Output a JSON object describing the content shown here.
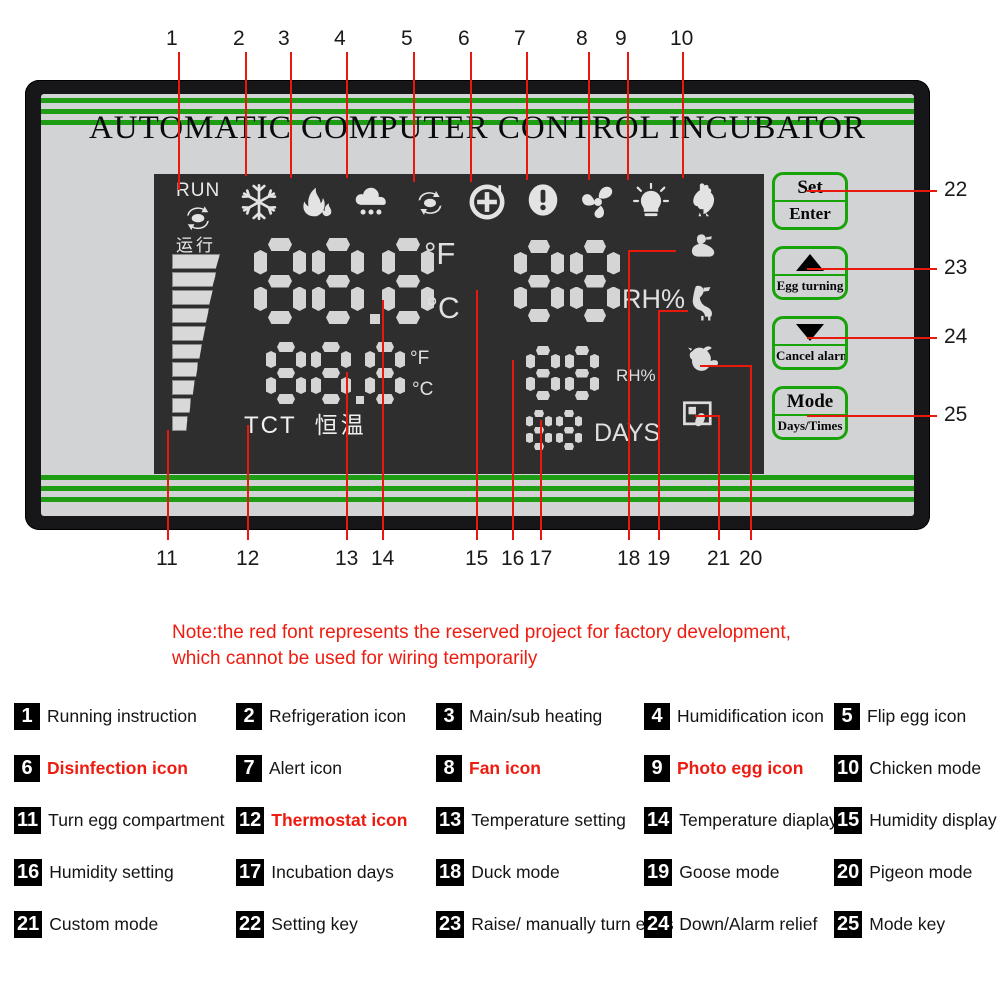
{
  "device": {
    "title": "AUTOMATIC  COMPUTER  CONTROL  INCUBATOR",
    "lcd": {
      "run_label": "RUN",
      "run_label_cn": "运行",
      "temperature_display": "88.8",
      "temperature_setting": "88.8",
      "unit_f": "°F",
      "unit_c": "°C",
      "humidity_display": "88",
      "humidity_setting": "88",
      "humidity_unit": "RH%",
      "days_value": "88",
      "days_unit": "DAYS",
      "thermostat_label": "TCT",
      "thermostat_label_cn": "恒温",
      "status_icons": [
        "running-egg-turn-icon",
        "snowflake-refrigeration-icon",
        "flame-heating-icon",
        "rain-cloud-humidification-icon",
        "flip-egg-icon",
        "plus-circle-disinfection-icon",
        "alert-exclamation-icon",
        "fan-icon",
        "lamp-photo-egg-icon",
        "rooster-chicken-mode-icon"
      ],
      "mode_icons": [
        "duck-mode-icon",
        "goose-mode-icon",
        "pigeon-mode-icon",
        "custom-mode-icon"
      ]
    },
    "buttons": [
      {
        "top": "Set",
        "bottom": "Enter",
        "icon": "none"
      },
      {
        "top": "",
        "bottom": "Egg turning",
        "icon": "up-arrow-icon"
      },
      {
        "top": "",
        "bottom": "Cancel alarm",
        "icon": "down-arrow-icon"
      },
      {
        "top": "Mode",
        "bottom": "Days/Times",
        "icon": "none"
      }
    ],
    "accent_green": "#18a409",
    "callout_red": "#e8180c"
  },
  "callouts": {
    "top": [
      "1",
      "2",
      "3",
      "4",
      "5",
      "6",
      "7",
      "8",
      "9",
      "10"
    ],
    "bottom": [
      "11",
      "12",
      "13",
      "14",
      "15",
      "16",
      "17",
      "18",
      "19",
      "21",
      "20"
    ],
    "right": [
      "22",
      "23",
      "24",
      "25"
    ]
  },
  "note": {
    "line1": "Note:the red font represents the reserved project for factory development,",
    "line2": "which cannot be used for wiring temporarily"
  },
  "legend": [
    {
      "num": "1",
      "label": "Running instruction",
      "red": false
    },
    {
      "num": "2",
      "label": "Refrigeration icon",
      "red": false
    },
    {
      "num": "3",
      "label": "Main/sub heating",
      "red": false
    },
    {
      "num": "4",
      "label": "Humidification icon",
      "red": false
    },
    {
      "num": "5",
      "label": "Flip egg icon",
      "red": false
    },
    {
      "num": "6",
      "label": "Disinfection icon",
      "red": true
    },
    {
      "num": "7",
      "label": "Alert icon",
      "red": false
    },
    {
      "num": "8",
      "label": "Fan icon",
      "red": true
    },
    {
      "num": "9",
      "label": "Photo egg icon",
      "red": true
    },
    {
      "num": "10",
      "label": "Chicken mode",
      "red": false
    },
    {
      "num": "11",
      "label": "Turn egg compartment",
      "red": false
    },
    {
      "num": "12",
      "label": "Thermostat icon",
      "red": true
    },
    {
      "num": "13",
      "label": "Temperature setting",
      "red": false
    },
    {
      "num": "14",
      "label": "Temperature diaplay",
      "red": false
    },
    {
      "num": "15",
      "label": "Humidity display",
      "red": false
    },
    {
      "num": "16",
      "label": "Humidity setting",
      "red": false
    },
    {
      "num": "17",
      "label": "Incubation days",
      "red": false
    },
    {
      "num": "18",
      "label": "Duck mode",
      "red": false
    },
    {
      "num": "19",
      "label": "Goose mode",
      "red": false
    },
    {
      "num": "20",
      "label": "Pigeon mode",
      "red": false
    },
    {
      "num": "21",
      "label": "Custom mode",
      "red": false
    },
    {
      "num": "22",
      "label": "Setting key",
      "red": false
    },
    {
      "num": "23",
      "label": "Raise/ manually turn eggs",
      "red": false
    },
    {
      "num": "24",
      "label": "Down/Alarm relief",
      "red": false
    },
    {
      "num": "25",
      "label": "Mode key",
      "red": false
    }
  ]
}
